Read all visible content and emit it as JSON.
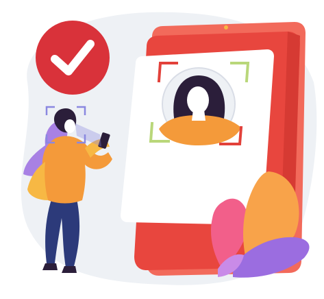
{
  "illustration": {
    "palette": {
      "background_blob": "#eef1f5",
      "phone_red": "#e8463e",
      "phone_red_dark": "#d63a33",
      "phone_red_light": "#f26a5b",
      "screen_white": "#ffffff",
      "check_badge": "#d9323a",
      "frame_red": "#e2413a",
      "frame_green": "#b9d77a",
      "hair_dark": "#2b1e3a",
      "skin": "#ffffff",
      "shirt_orange": "#f49a3a",
      "shirt_yellow": "#f7b844",
      "pants_navy": "#2c3a7a",
      "scan_purple": "#8a88e0",
      "leaf_pink": "#f25f8a",
      "leaf_orange": "#f8a34a",
      "leaf_purple": "#9b6de0"
    },
    "icons": [
      "check-icon",
      "face-scan-frame-icon",
      "user-avatar-icon",
      "smartphone-icon"
    ]
  }
}
